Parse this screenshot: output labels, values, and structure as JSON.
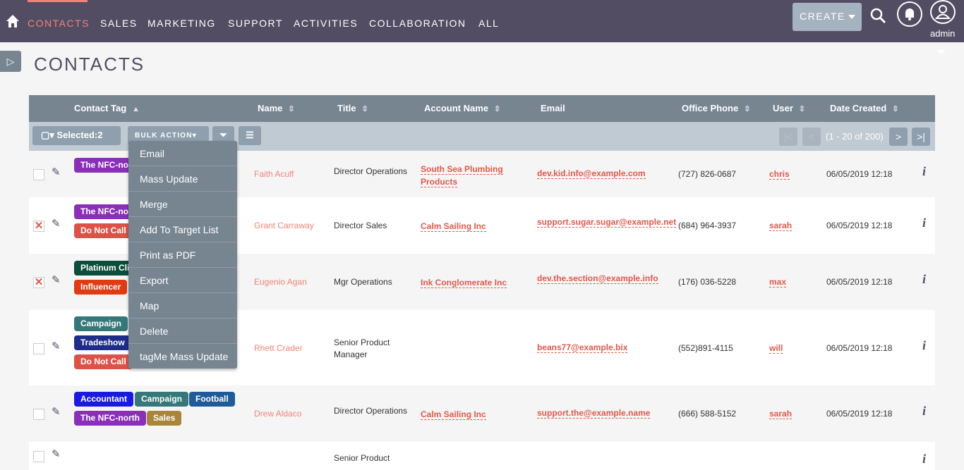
{
  "nav": {
    "items": [
      "CONTACTS",
      "SALES",
      "MARKETING",
      "SUPPORT",
      "ACTIVITIES",
      "COLLABORATION",
      "ALL"
    ],
    "create": "CREATE",
    "user": "admin"
  },
  "page": {
    "title": "CONTACTS"
  },
  "table": {
    "headers": [
      "Contact Tag",
      "Name",
      "Title",
      "Account Name",
      "Email",
      "Office Phone",
      "User",
      "Date Created"
    ],
    "selected": "Selected:2",
    "bulk_action": "BULK ACTION",
    "pagination": "(1 - 20 of 200)",
    "rows": [
      {
        "checked": false,
        "tags": [
          {
            "label": "The NFC-north",
            "color": "#8a2fb8"
          }
        ],
        "name": "Faith Acuff",
        "title": "Director Operations",
        "account": "South Sea Plumbing Products",
        "email": "dev.kid.info@example.com",
        "phone": "(727) 826-0687",
        "user": "chris",
        "date": "06/05/2019 12:18"
      },
      {
        "checked": true,
        "tags": [
          {
            "label": "The NFC-north",
            "color": "#8a2fb8"
          },
          {
            "label": "Do Not Call",
            "color": "#dc5249"
          }
        ],
        "name": "Grant Carraway",
        "title": "Director Sales",
        "account": "Calm Sailing Inc",
        "email": "support.sugar.sugar@example.net",
        "phone": "(684) 964-3937",
        "user": "sarah",
        "date": "06/05/2019 12:18"
      },
      {
        "checked": true,
        "tags": [
          {
            "label": "Platinum Client",
            "color": "#0b4d3a"
          },
          {
            "label": "Influencer",
            "color": "#e03b12"
          }
        ],
        "name": "Eugenio Agan",
        "title": "Mgr Operations",
        "account": "Ink Conglomerate Inc",
        "email": "dev.the.section@example.info",
        "phone": "(176) 036-5228",
        "user": "max",
        "date": "06/05/2019 12:18"
      },
      {
        "checked": false,
        "tags": [
          {
            "label": "Campaign",
            "color": "#36777a"
          },
          {
            "label": "Tradeshow",
            "color": "#1f2d8a"
          },
          {
            "label": "Do Not Call",
            "color": "#dc5249"
          }
        ],
        "name": "Rhett Crader",
        "title": "Senior Product Manager",
        "account": "",
        "email": "beans77@example.bix",
        "phone": "(552)891-4115",
        "user": "will",
        "date": "06/05/2019 12:18"
      },
      {
        "checked": false,
        "tags": [
          {
            "label": "Accountant",
            "color": "#1a1ae0"
          },
          {
            "label": "Campaign",
            "color": "#36777a"
          },
          {
            "label": "Football",
            "color": "#1f5b99"
          },
          {
            "label": "The NFC-north",
            "color": "#8a2fb8"
          },
          {
            "label": "Sales",
            "color": "#a8853a"
          }
        ],
        "name": "Drew Aldaco",
        "title": "Director Operations",
        "account": "Calm Sailing Inc",
        "email": "support.the@example.name",
        "phone": "(666) 588-5152",
        "user": "sarah",
        "date": "06/05/2019 12:18"
      },
      {
        "checked": false,
        "tags": [],
        "name": "",
        "title": "Senior Product",
        "account": "",
        "email": "",
        "phone": "",
        "user": "",
        "date": ""
      }
    ]
  },
  "bulk_menu": [
    "Email",
    "Mass Update",
    "Merge",
    "Add To Target List",
    "Print as PDF",
    "Export",
    "Map",
    "Delete",
    "tagMe Mass Update"
  ]
}
